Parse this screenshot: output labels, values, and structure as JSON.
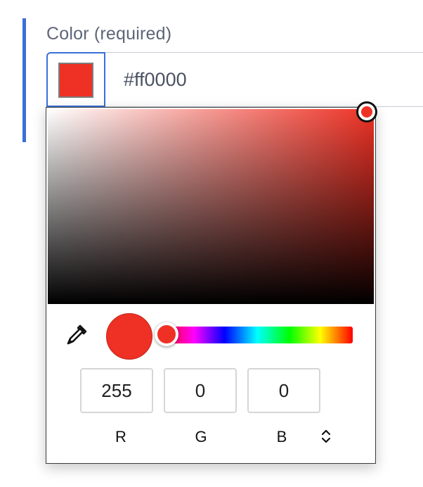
{
  "field": {
    "label": "Color (required)",
    "hex_value": "#ff0000",
    "swatch_color": "#ee3124",
    "accent_color": "#3a6fd8"
  },
  "picker": {
    "current_color": "#ee3124",
    "hue": 0,
    "saturation": 1.0,
    "value": 1.0,
    "rgb": {
      "r": "255",
      "g": "0",
      "b": "0"
    },
    "labels": {
      "r": "R",
      "g": "G",
      "b": "B"
    },
    "icons": {
      "eyedropper": "eyedropper-icon",
      "mode_toggle": "chevron-up-down-icon"
    }
  }
}
